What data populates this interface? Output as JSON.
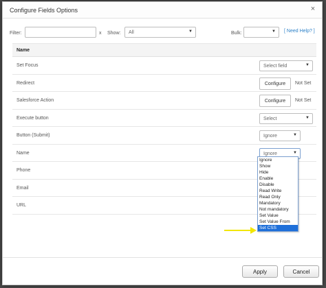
{
  "dialog": {
    "title": "Configure Fields Options",
    "close_glyph": "×"
  },
  "filter": {
    "filter_label": "Filter:",
    "filter_value": "",
    "clear_glyph": "x",
    "show_label": "Show:",
    "show_value": "All",
    "bulk_label": "Bulk:",
    "bulk_value": "",
    "help_link": "[ Need Help? ]"
  },
  "table": {
    "header": "Name",
    "rows": [
      {
        "name": "Set Focus",
        "control": "Select field"
      },
      {
        "name": "Redirect",
        "button": "Configure",
        "status": "Not Set"
      },
      {
        "name": "Salesforce Action",
        "button": "Configure",
        "status": "Not Set"
      },
      {
        "name": "Execute button",
        "control": "Select"
      },
      {
        "name": "Button (Submit)",
        "control": "Ignore"
      },
      {
        "name": "Name",
        "control": "Ignore"
      },
      {
        "name": "Phone"
      },
      {
        "name": "Email"
      },
      {
        "name": "URL"
      }
    ]
  },
  "dropdown": {
    "options": [
      "Ignore",
      "Show",
      "Hide",
      "Enable",
      "Disable",
      "Read Write",
      "Read Only",
      "Mandatory",
      "Not mandatory",
      "Set Value",
      "Set Value From",
      "Set CSS"
    ],
    "selected_index": 11
  },
  "footer": {
    "apply_label": "Apply",
    "cancel_label": "Cancel"
  },
  "colors": {
    "accent": "#1e6fd9",
    "arrow": "#f2e600",
    "link": "#2a7fc7"
  },
  "icons": {
    "caret": "caret-down-icon",
    "arrow": "arrow-right-icon",
    "close": "close-icon"
  }
}
